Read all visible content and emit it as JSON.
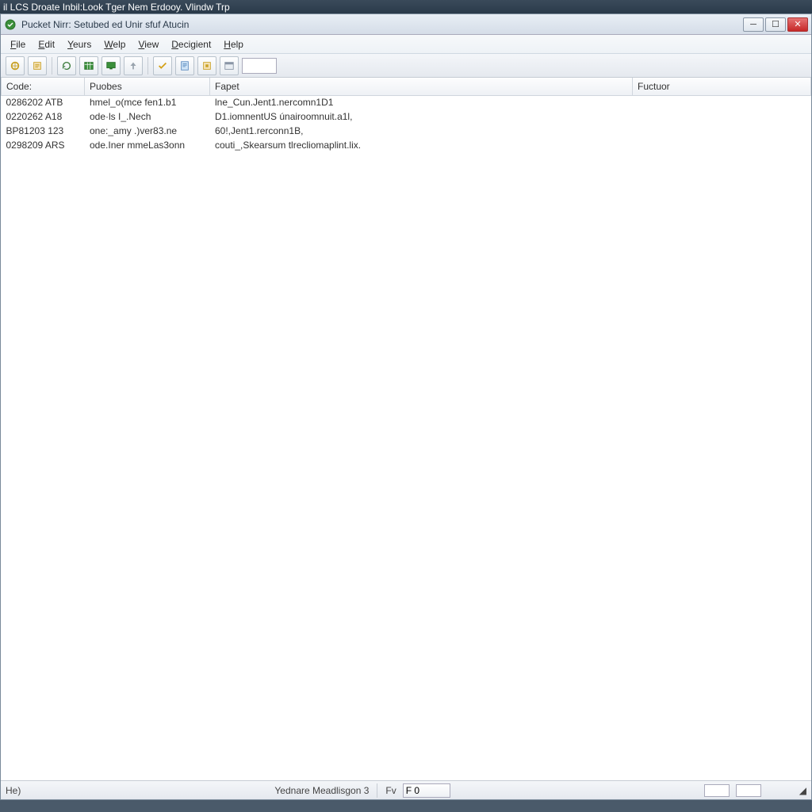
{
  "outer_title": "il LCS Droate Inbil:Look Tger Nem Erdooy. Vlindw Trp",
  "titlebar": {
    "title": "Pucket Nirr: Setubed ed Unir sfuf Atucin"
  },
  "menu": {
    "items": [
      "File",
      "Edit",
      "Yeurs",
      "Welp",
      "View",
      "Decigient",
      "Help"
    ]
  },
  "columns": {
    "c1": "Code:",
    "c2": "Puobes",
    "c3": "Fapet",
    "c4": "Fuctuor"
  },
  "rows": [
    {
      "c1": "0286202 ATB",
      "c2": "hmel_o(mce fen1.b1",
      "c3": "lne_Cun.Jent1.nercomn1D1"
    },
    {
      "c1": "0220262 A18",
      "c2": "ode·ls I_.Nech",
      "c3": "D1.iomnentUS únairoomnuit.a1l,"
    },
    {
      "c1": "BP81203 123",
      "c2": "one:_amy .)ver83.ne",
      "c3": "60!,Jent1.rerconn1B,"
    },
    {
      "c1": "0298209 ARS",
      "c2": "ode.Iner mmeLas3onn",
      "c3": "couti_,Skearsum tlrecliomaplint.lix."
    }
  ],
  "status": {
    "left": "He)",
    "center": "Yednare Meadlisgon 3",
    "fv_label": "Fv",
    "fv_value": "F 0",
    "grip": "◢"
  }
}
